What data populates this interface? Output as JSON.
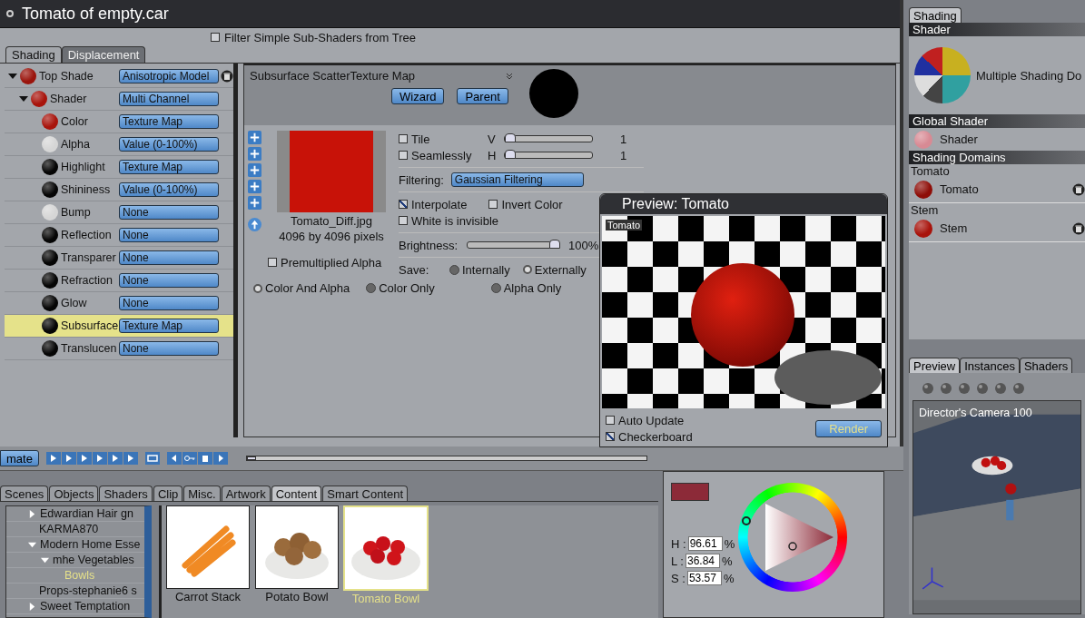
{
  "window": {
    "title": "Tomato of empty.car"
  },
  "filter_checkbox": {
    "label": "Filter Simple Sub-Shaders from Tree",
    "checked": false
  },
  "editor_tabs": [
    {
      "label": "Shading",
      "selected": true
    },
    {
      "label": "Displacement",
      "selected": false
    }
  ],
  "shader_tree": [
    {
      "name": "Top Shade",
      "color": "#9a140c",
      "value": "Anisotropic Model",
      "selected": false,
      "expanded": true,
      "children": [
        {
          "name": "Shader",
          "color": "#a8140c",
          "value": "Multi Channel",
          "selected": false,
          "expanded": true,
          "children": [
            {
              "name": "Color",
              "color": "#a8140c",
              "value": "Texture Map",
              "selected": false
            },
            {
              "name": "Alpha",
              "color": "#d6d6d6",
              "value": "Value (0-100%)",
              "selected": false
            },
            {
              "name": "Highlight",
              "color": "#050505",
              "value": "Texture Map",
              "selected": false
            },
            {
              "name": "Shininess",
              "color": "#050505",
              "value": "Value (0-100%)",
              "selected": false
            },
            {
              "name": "Bump",
              "color": "#d6d6d6",
              "value": "None",
              "selected": false
            },
            {
              "name": "Reflection",
              "color": "#050505",
              "value": "None",
              "selected": false
            },
            {
              "name": "Transparer",
              "color": "#050505",
              "value": "None",
              "selected": false
            },
            {
              "name": "Refraction",
              "color": "#050505",
              "value": "None",
              "selected": false
            },
            {
              "name": "Glow",
              "color": "#050505",
              "value": "None",
              "selected": false
            },
            {
              "name": "Subsurface",
              "color": "#050505",
              "value": "Texture Map",
              "selected": true
            },
            {
              "name": "Translucen",
              "color": "#050505",
              "value": "None",
              "selected": false
            }
          ]
        }
      ]
    }
  ],
  "texture_editor": {
    "channel": "Subsurface Scatter",
    "map_type": "Texture Map",
    "buttons": [
      "Wizard",
      "Parent"
    ],
    "file_name": "Tomato_Diff.jpg",
    "dimensions": "4096 by 4096 pixels",
    "tiling": [
      {
        "label": "Tile",
        "checked": false,
        "axis": "V",
        "level": 0.05,
        "reading": "1"
      },
      {
        "label": "Seamlessly",
        "checked": false,
        "axis": "H",
        "level": 0.05,
        "reading": "1"
      }
    ],
    "filtering": {
      "label": "Filtering:",
      "value": "Gaussian Filtering"
    },
    "options": [
      {
        "label": "Interpolate",
        "checked": true
      },
      {
        "label": "Invert Color",
        "checked": false
      },
      {
        "label": "White is invisible",
        "checked": false
      }
    ],
    "brightness": {
      "label": "Brightness:",
      "level": 0.95,
      "reading": "100%"
    },
    "save": {
      "label": "Save:",
      "options": [
        {
          "label": "Internally",
          "selected": false
        },
        {
          "label": "Externally",
          "selected": true
        }
      ]
    },
    "premultiplied": {
      "label": "Premultiplied Alpha",
      "checked": false
    },
    "alpha_modes": [
      {
        "label": "Color And Alpha",
        "selected": true
      },
      {
        "label": "Color Only",
        "selected": false
      },
      {
        "label": "Alpha Only",
        "selected": false
      }
    ]
  },
  "preview_window": {
    "title": "Preview: Tomato",
    "overlay_label": "Tomato",
    "auto_update": {
      "label": "Auto Update",
      "checked": false
    },
    "checkerboard": {
      "label": "Checkerboard",
      "checked": true
    },
    "render_button": "Render"
  },
  "animation_bar": {
    "button": "mate",
    "level": 0.0
  },
  "library": {
    "tabs": [
      {
        "label": "Scenes",
        "selected": false
      },
      {
        "label": "Objects",
        "selected": false
      },
      {
        "label": "Shaders",
        "selected": false
      },
      {
        "label": "Clip",
        "selected": false
      },
      {
        "label": "Misc.",
        "selected": false
      },
      {
        "label": "Artwork",
        "selected": false
      },
      {
        "label": "Content",
        "selected": true
      },
      {
        "label": "Smart Content",
        "selected": false
      }
    ],
    "tree": [
      {
        "label": "Edwardian Hair gn",
        "kind": "folder",
        "expanded": false,
        "selected": false
      },
      {
        "label": "KARMA870",
        "kind": "leaf",
        "selected": false
      },
      {
        "label": "Modern Home Esse",
        "kind": "folder",
        "expanded": true,
        "selected": false,
        "children": [
          {
            "label": "mhe Vegetables",
            "kind": "folder",
            "expanded": true,
            "selected": false,
            "children": [
              {
                "label": "Bowls",
                "kind": "leaf",
                "selected": true
              }
            ]
          }
        ]
      },
      {
        "label": "Props-stephanie6 s",
        "kind": "leaf",
        "selected": false
      },
      {
        "label": "Sweet Temptation",
        "kind": "folder",
        "expanded": false,
        "selected": false
      }
    ],
    "items": [
      {
        "label": "Carrot Stack",
        "kind": "carrots",
        "selected": false
      },
      {
        "label": "Potato Bowl",
        "kind": "potatoes",
        "selected": false
      },
      {
        "label": "Tomato Bowl",
        "kind": "tomatoes",
        "selected": true
      }
    ]
  },
  "color_picker": {
    "color": "#8c2a38",
    "fields": [
      {
        "label": "H :",
        "value": "96.61",
        "unit": "%"
      },
      {
        "label": "L :",
        "value": "36.84",
        "unit": "%"
      },
      {
        "label": "S :",
        "value": "53.57",
        "unit": "%"
      }
    ]
  },
  "shading_panel": {
    "tab": "Shading",
    "shader_section": "Shader",
    "shader_name": "Multiple Shading Do",
    "global_section": "Global Shader",
    "global_item": {
      "name": "Shader",
      "color": "#d88a94"
    },
    "domains_section": "Shading Domains",
    "domains": [
      {
        "group": "Tomato",
        "name": "Tomato",
        "color": "#8e0e08"
      },
      {
        "group": "Stem",
        "name": "Stem",
        "color": "#a8140c"
      }
    ]
  },
  "preview_panel": {
    "tabs": [
      {
        "label": "Preview",
        "selected": true
      },
      {
        "label": "Instances",
        "selected": false
      },
      {
        "label": "Shaders",
        "selected": false
      }
    ],
    "camera": "Director's Camera 100"
  }
}
